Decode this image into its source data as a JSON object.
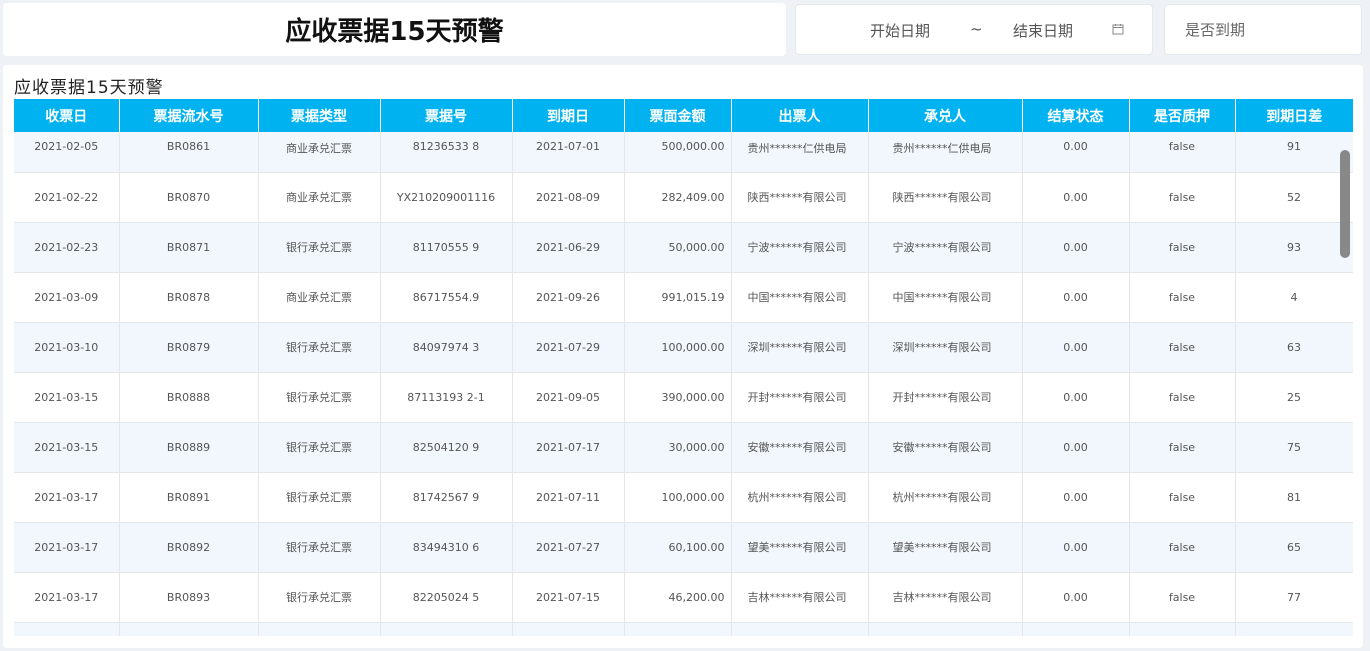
{
  "header": {
    "title": "应收票据15天预警",
    "date_range": {
      "start_label": "开始日期",
      "separator": "~",
      "end_label": "结束日期",
      "calendar_icon": "calendar-icon"
    },
    "expire_filter": {
      "placeholder": "是否到期"
    }
  },
  "panel": {
    "title": "应收票据15天预警",
    "columns": [
      "收票日",
      "票据流水号",
      "票据类型",
      "票据号",
      "到期日",
      "票面金额",
      "出票人",
      "承兑人",
      "结算状态",
      "是否质押",
      "到期日差"
    ],
    "rows": [
      [
        "2021-02-05",
        "BR0861",
        "商业承兑汇票",
        "81236533 8",
        "2021-07-01",
        "500,000.00",
        "贵州******仁供电局",
        "贵州******仁供电局",
        "0.00",
        "false",
        "91"
      ],
      [
        "2021-02-22",
        "BR0870",
        "商业承兑汇票",
        "YX210209001116",
        "2021-08-09",
        "282,409.00",
        "陕西******有限公司",
        "陕西******有限公司",
        "0.00",
        "false",
        "52"
      ],
      [
        "2021-02-23",
        "BR0871",
        "银行承兑汇票",
        "81170555 9",
        "2021-06-29",
        "50,000.00",
        "宁波******有限公司",
        "宁波******有限公司",
        "0.00",
        "false",
        "93"
      ],
      [
        "2021-03-09",
        "BR0878",
        "商业承兑汇票",
        "86717554.9",
        "2021-09-26",
        "991,015.19",
        "中国******有限公司",
        "中国******有限公司",
        "0.00",
        "false",
        "4"
      ],
      [
        "2021-03-10",
        "BR0879",
        "银行承兑汇票",
        "84097974 3",
        "2021-07-29",
        "100,000.00",
        "深圳******有限公司",
        "深圳******有限公司",
        "0.00",
        "false",
        "63"
      ],
      [
        "2021-03-15",
        "BR0888",
        "银行承兑汇票",
        "87113193 2-1",
        "2021-09-05",
        "390,000.00",
        "开封******有限公司",
        "开封******有限公司",
        "0.00",
        "false",
        "25"
      ],
      [
        "2021-03-15",
        "BR0889",
        "银行承兑汇票",
        "82504120 9",
        "2021-07-17",
        "30,000.00",
        "安徽******有限公司",
        "安徽******有限公司",
        "0.00",
        "false",
        "75"
      ],
      [
        "2021-03-17",
        "BR0891",
        "银行承兑汇票",
        "81742567 9",
        "2021-07-11",
        "100,000.00",
        "杭州******有限公司",
        "杭州******有限公司",
        "0.00",
        "false",
        "81"
      ],
      [
        "2021-03-17",
        "BR0892",
        "银行承兑汇票",
        "83494310 6",
        "2021-07-27",
        "60,100.00",
        "望美******有限公司",
        "望美******有限公司",
        "0.00",
        "false",
        "65"
      ],
      [
        "2021-03-17",
        "BR0893",
        "银行承兑汇票",
        "82205024 5",
        "2021-07-15",
        "46,200.00",
        "吉林******有限公司",
        "吉林******有限公司",
        "0.00",
        "false",
        "77"
      ],
      [
        "",
        "",
        "",
        "",
        "",
        "",
        "",
        "",
        "",
        "",
        ""
      ]
    ]
  }
}
